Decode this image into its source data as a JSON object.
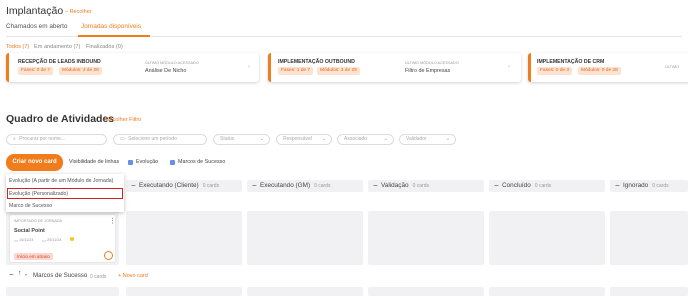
{
  "header": {
    "title": "Implantação",
    "collapse_label": "– Recolher"
  },
  "main_tabs": [
    {
      "label": "Chamados em aberto",
      "active": false
    },
    {
      "label": "Jornadas disponíveis",
      "active": true
    }
  ],
  "sub_tabs": [
    {
      "label": "Todos (7)",
      "active": true
    },
    {
      "label": "Em andamento (7)",
      "active": false
    },
    {
      "label": "Finalizados (0)",
      "active": false
    }
  ],
  "journey_cards": [
    {
      "title": "RECEPÇÃO DE LEADS INBOUND",
      "phases": "Fases: 0 de 7",
      "modules": "Módulos: 4 de 26",
      "last_module_label": "ÚLTIMO MÓDULO ACESSADO",
      "last_module": "Análise De Nicho"
    },
    {
      "title": "IMPLEMENTAÇÃO OUTBOUND",
      "phases": "Fases: 1 de 7",
      "modules": "Módulos: 3 de 29",
      "last_module_label": "ÚLTIMO MÓDULO ACESSADO",
      "last_module": "Filtro de Empresas"
    },
    {
      "title": "IMPLEMENTAÇÃO DE CRM",
      "phases": "Fases: 0 de 3",
      "modules": "Módulos: 0 de 28",
      "last_module_label": "ÚLTIMO",
      "last_module": ""
    }
  ],
  "board": {
    "title": "Quadro de Atividades",
    "collapse_filter_label": "– Recolher Filtro",
    "search_placeholder": "Procurar por nome...",
    "period_placeholder": "Selecione um período",
    "filters": [
      "Status",
      "Responsável",
      "Associado",
      "Validador"
    ],
    "create_button": "Criar novo card",
    "visibility_label": "Visibilidade de linhas",
    "visibility_options": [
      "Evolução",
      "Marcos de Sucesso"
    ]
  },
  "dropdown": {
    "items": [
      "Evolução (A partir de um Módulo de Jornada)",
      "Evolução (Personalizado)",
      "Marco de Sucesso"
    ],
    "highlighted_index": 1
  },
  "columns": [
    {
      "title": "Executando (Cliente)",
      "count": "0 cards"
    },
    {
      "title": "Executando (GM)",
      "count": "0 cards"
    },
    {
      "title": "Validação",
      "count": "0 cards"
    },
    {
      "title": "Concluído",
      "count": "0 cards"
    },
    {
      "title": "Ignorado",
      "count": "0 cards"
    }
  ],
  "sample_card": {
    "type_label": "IMPORTADO DE JORNADA",
    "title": "Social Point",
    "date_start": "15/11/24",
    "date_end": "20/11/24",
    "status": "Início em atraso"
  },
  "success_row": {
    "title": "Marcos de Sucesso",
    "count": "0 cards",
    "new_label": "+ Novo card"
  },
  "colors": {
    "accent": "#f07c1c",
    "highlight": "#d42020",
    "checkbox": "#6b8ee8"
  }
}
